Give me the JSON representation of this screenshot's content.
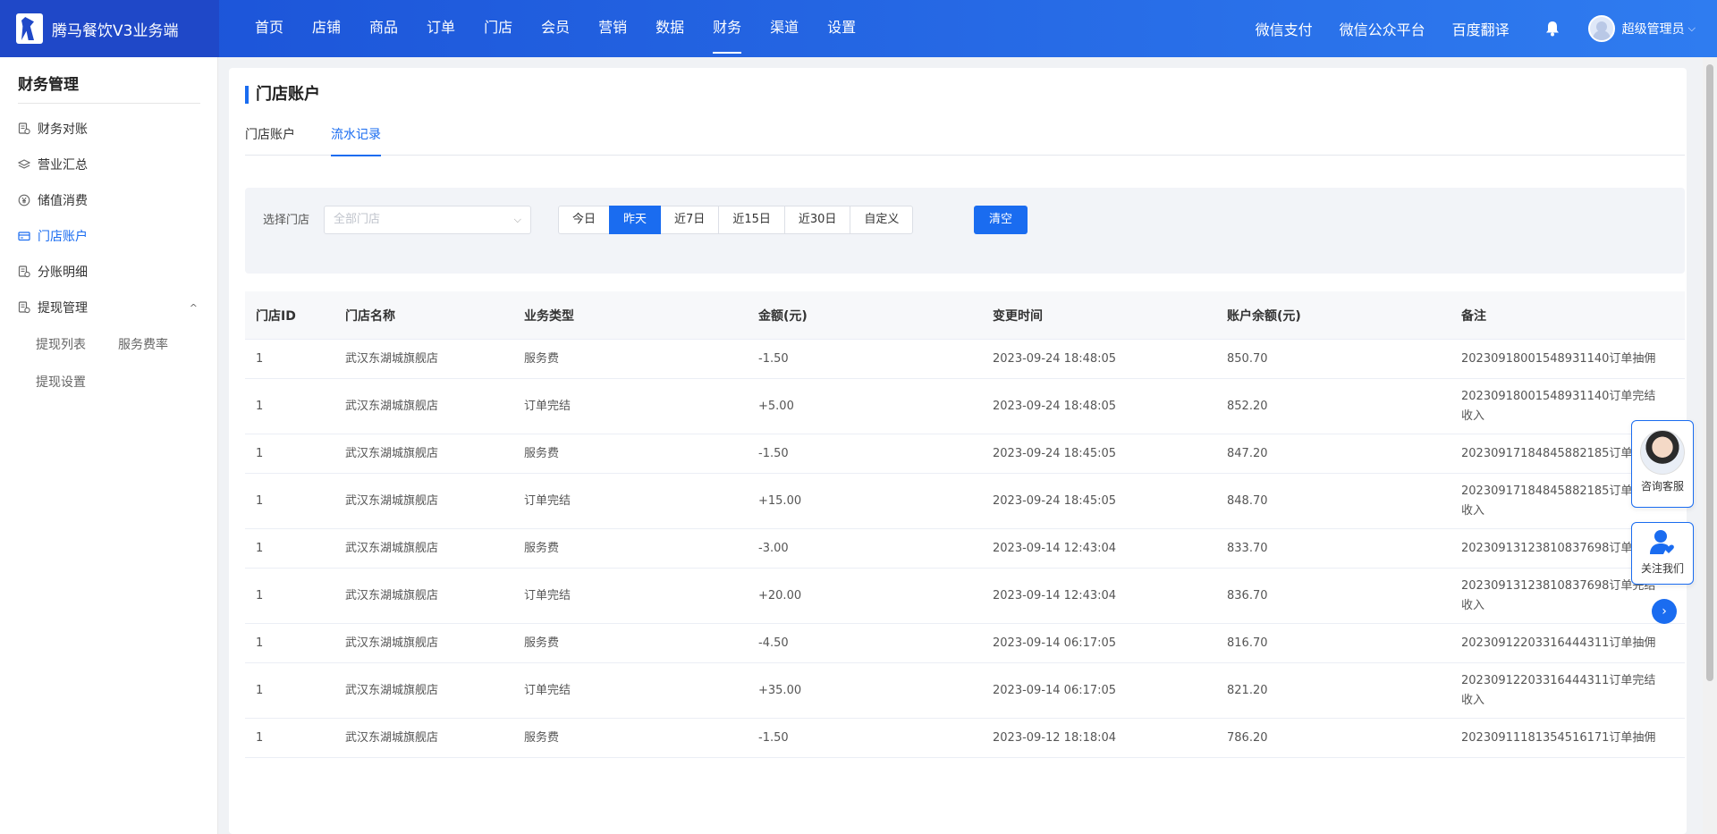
{
  "brand": {
    "name": "腾马餐饮V3业务端"
  },
  "nav": {
    "items": [
      "首页",
      "店铺",
      "商品",
      "订单",
      "门店",
      "会员",
      "营销",
      "数据",
      "财务",
      "渠道",
      "设置"
    ],
    "active_index": 8
  },
  "header": {
    "links": [
      "微信支付",
      "微信公众平台",
      "百度翻译"
    ],
    "user_name": "超级管理员",
    "caret": "⌵"
  },
  "sidebar": {
    "title": "财务管理",
    "items": [
      {
        "label": "财务对账",
        "icon": "ledger-icon"
      },
      {
        "label": "营业汇总",
        "icon": "layers-icon"
      },
      {
        "label": "储值消费",
        "icon": "yen-circle-icon"
      },
      {
        "label": "门店账户",
        "icon": "card-icon"
      },
      {
        "label": "分账明细",
        "icon": "ledger-icon"
      },
      {
        "label": "提现管理",
        "icon": "ledger-icon"
      }
    ],
    "active_index": 3,
    "chevron": "^",
    "sub_items": [
      "提现列表",
      "服务费率",
      "提现设置"
    ]
  },
  "page": {
    "title": "门店账户",
    "tabs": [
      "门店账户",
      "流水记录"
    ],
    "active_tab": 1
  },
  "filter": {
    "label": "选择门店",
    "select_placeholder": "全部门店",
    "select_arrow": "⌵",
    "date_buttons": [
      "今日",
      "昨天",
      "近7日",
      "近15日",
      "近30日",
      "自定义"
    ],
    "active_date": 1,
    "clear_label": "清空"
  },
  "table": {
    "headers": [
      "门店ID",
      "门店名称",
      "业务类型",
      "金额(元)",
      "变更时间",
      "账户余额(元)",
      "备注"
    ],
    "rows": [
      [
        "1",
        "武汉东湖城旗舰店",
        "服务费",
        "-1.50",
        "2023-09-24 18:48:05",
        "850.70",
        "20230918001548931140订单抽佣"
      ],
      [
        "1",
        "武汉东湖城旗舰店",
        "订单完结",
        "+5.00",
        "2023-09-24 18:48:05",
        "852.20",
        "20230918001548931140订单完结收入"
      ],
      [
        "1",
        "武汉东湖城旗舰店",
        "服务费",
        "-1.50",
        "2023-09-24 18:45:05",
        "847.20",
        "20230917184845882185订单抽佣"
      ],
      [
        "1",
        "武汉东湖城旗舰店",
        "订单完结",
        "+15.00",
        "2023-09-24 18:45:05",
        "848.70",
        "20230917184845882185订单完结收入"
      ],
      [
        "1",
        "武汉东湖城旗舰店",
        "服务费",
        "-3.00",
        "2023-09-14 12:43:04",
        "833.70",
        "20230913123810837698订单抽佣"
      ],
      [
        "1",
        "武汉东湖城旗舰店",
        "订单完结",
        "+20.00",
        "2023-09-14 12:43:04",
        "836.70",
        "20230913123810837698订单完结收入"
      ],
      [
        "1",
        "武汉东湖城旗舰店",
        "服务费",
        "-4.50",
        "2023-09-14 06:17:05",
        "816.70",
        "20230912203316444311订单抽佣"
      ],
      [
        "1",
        "武汉东湖城旗舰店",
        "订单完结",
        "+35.00",
        "2023-09-14 06:17:05",
        "821.20",
        "20230912203316444311订单完结收入"
      ],
      [
        "1",
        "武汉东湖城旗舰店",
        "服务费",
        "-1.50",
        "2023-09-12 18:18:04",
        "786.20",
        "20230911181354516171订单抽佣"
      ]
    ]
  },
  "widgets": {
    "consult_label": "咨询客服",
    "follow_label": "关注我们",
    "arrow": "›"
  },
  "colors": {
    "primary": "#1a6cf0",
    "header_start": "#1a50d6",
    "header_end": "#2f7cf0"
  }
}
